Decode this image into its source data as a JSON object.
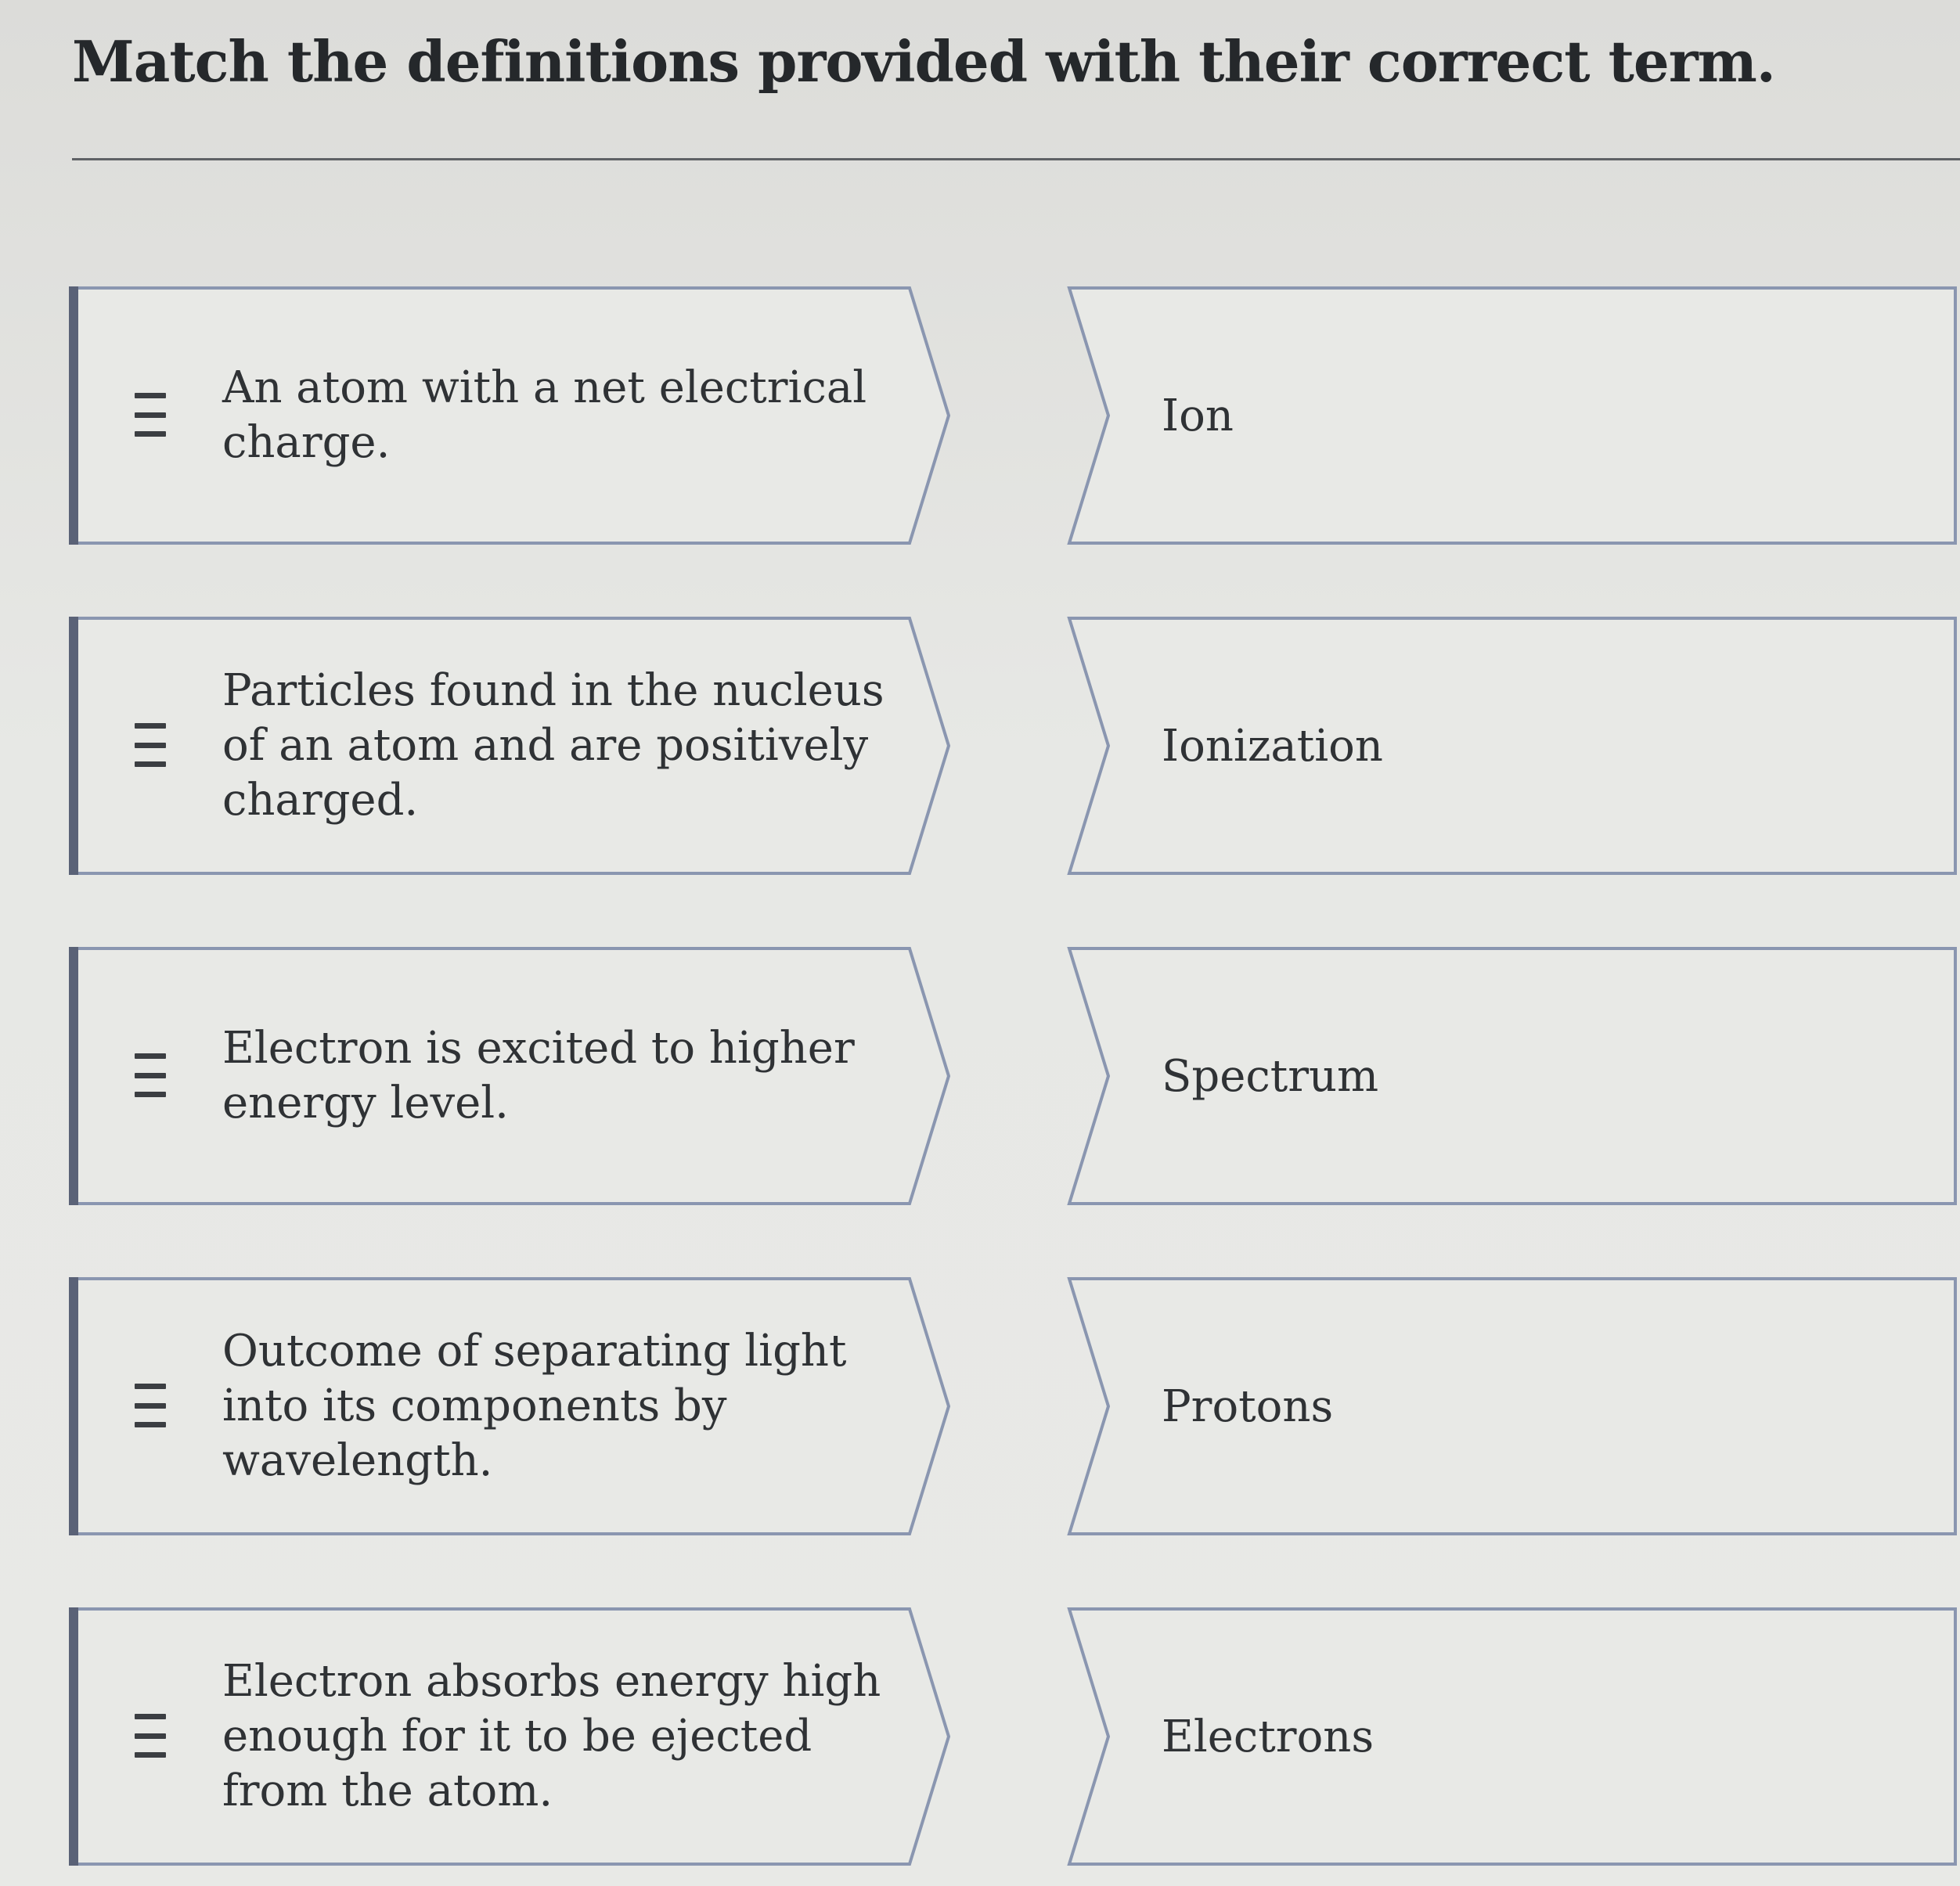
{
  "title": "Match the definitions provided with their correct term.",
  "colors": {
    "card_border": "#8a96b0",
    "accent_bar": "#5a6277",
    "card_fill": "#e8e9e6",
    "text": "#2f3235"
  },
  "icons": {
    "drag_handle": "drag-handle-icon"
  },
  "pairs": [
    {
      "definition": "An atom with a net electrical charge.",
      "term": "Ion"
    },
    {
      "definition": "Particles found in the nucleus of an atom and are positively charged.",
      "term": "Ionization"
    },
    {
      "definition": "Electron is excited to higher energy level.",
      "term": "Spectrum"
    },
    {
      "definition": "Outcome of separating light into its components by wavelength.",
      "term": "Protons"
    },
    {
      "definition": "Electron absorbs energy high enough for it to be ejected from the atom.",
      "term": "Electrons"
    }
  ]
}
